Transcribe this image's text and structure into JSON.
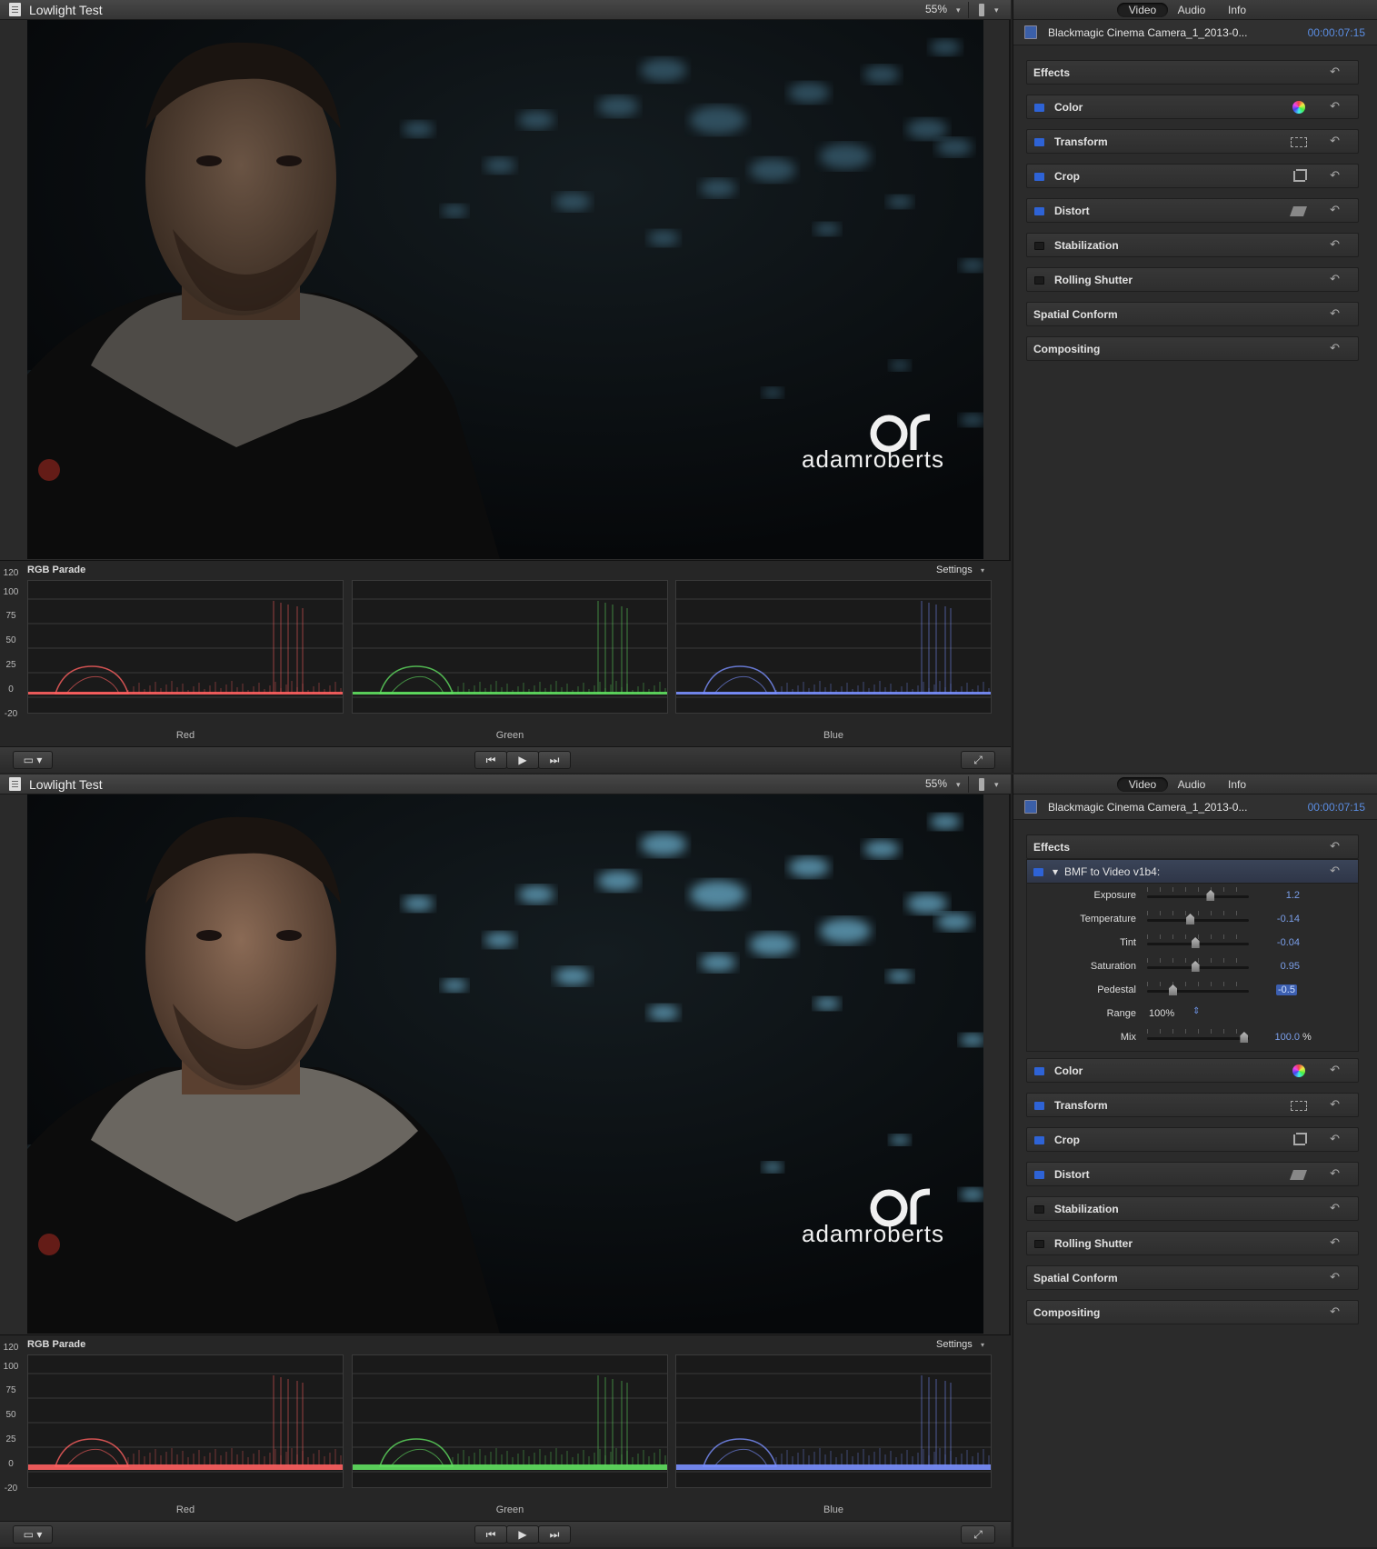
{
  "panels": [
    {
      "viewer": {
        "title": "Lowlight Test",
        "zoom": "55%",
        "zoom_caret": "▾",
        "watermark_brand": "adamroberts",
        "scope": {
          "title": "RGB Parade",
          "settings_label": "Settings",
          "y_ticks": [
            "120",
            "100",
            "75",
            "50",
            "25",
            "0",
            "-20"
          ],
          "channels": [
            {
              "label": "Red",
              "color": "#ff6060"
            },
            {
              "label": "Green",
              "color": "#60e060"
            },
            {
              "label": "Blue",
              "color": "#7a90ff"
            }
          ]
        },
        "transport": {
          "view_icon": "view-options-icon",
          "prev_icon": "skip-back-icon",
          "play_icon": "play-icon",
          "next_icon": "skip-forward-icon",
          "fullscreen_icon": "fullscreen-icon"
        }
      },
      "inspector": {
        "tabs": [
          {
            "label": "Video",
            "active": true
          },
          {
            "label": "Audio"
          },
          {
            "label": "Info"
          }
        ],
        "clip_name": "Blackmagic Cinema Camera_1_2013-0...",
        "timecode": "00:00:07:15",
        "sections": [
          {
            "label": "Effects",
            "checkbox": null
          },
          {
            "label": "Color",
            "checkbox": "on",
            "icon": "color-board-icon"
          },
          {
            "label": "Transform",
            "checkbox": "on",
            "icon": "transform-icon"
          },
          {
            "label": "Crop",
            "checkbox": "on",
            "icon": "crop-icon"
          },
          {
            "label": "Distort",
            "checkbox": "on",
            "icon": "distort-icon"
          },
          {
            "label": "Stabilization",
            "checkbox": "off"
          },
          {
            "label": "Rolling Shutter",
            "checkbox": "off"
          },
          {
            "label": "Spatial Conform",
            "checkbox": null
          },
          {
            "label": "Compositing",
            "checkbox": null
          }
        ]
      }
    },
    {
      "viewer": {
        "title": "Lowlight Test",
        "zoom": "55%",
        "zoom_caret": "▾",
        "watermark_brand": "adamroberts",
        "scope": {
          "title": "RGB Parade",
          "settings_label": "Settings",
          "y_ticks": [
            "120",
            "100",
            "75",
            "50",
            "25",
            "0",
            "-20"
          ],
          "channels": [
            {
              "label": "Red",
              "color": "#ff6060"
            },
            {
              "label": "Green",
              "color": "#60e060"
            },
            {
              "label": "Blue",
              "color": "#7a90ff"
            }
          ]
        }
      },
      "inspector": {
        "tabs": [
          {
            "label": "Video",
            "active": true
          },
          {
            "label": "Audio"
          },
          {
            "label": "Info"
          }
        ],
        "clip_name": "Blackmagic Cinema Camera_1_2013-0...",
        "timecode": "00:00:07:15",
        "effects_label": "Effects",
        "effect": {
          "label": "BMF to Video v1b4:",
          "params": [
            {
              "label": "Exposure",
              "value": "1.2",
              "level": 0.62
            },
            {
              "label": "Temperature",
              "value": "-0.14",
              "level": 0.42
            },
            {
              "label": "Tint",
              "value": "-0.04",
              "level": 0.47
            },
            {
              "label": "Saturation",
              "value": "0.95",
              "level": 0.47
            },
            {
              "label": "Pedestal",
              "value": "-0.5",
              "level": 0.25,
              "selected": true
            },
            {
              "label": "Range",
              "value": "100%"
            },
            {
              "label": "Mix",
              "value": "100.0",
              "unit": "%",
              "level": 0.95
            }
          ]
        },
        "sections": [
          {
            "label": "Color",
            "checkbox": "on",
            "icon": "color-board-icon"
          },
          {
            "label": "Transform",
            "checkbox": "on",
            "icon": "transform-icon"
          },
          {
            "label": "Crop",
            "checkbox": "on",
            "icon": "crop-icon"
          },
          {
            "label": "Distort",
            "checkbox": "on",
            "icon": "distort-icon"
          },
          {
            "label": "Stabilization",
            "checkbox": "off"
          },
          {
            "label": "Rolling Shutter",
            "checkbox": "off"
          },
          {
            "label": "Spatial Conform",
            "checkbox": null
          },
          {
            "label": "Compositing",
            "checkbox": null
          }
        ]
      }
    }
  ]
}
